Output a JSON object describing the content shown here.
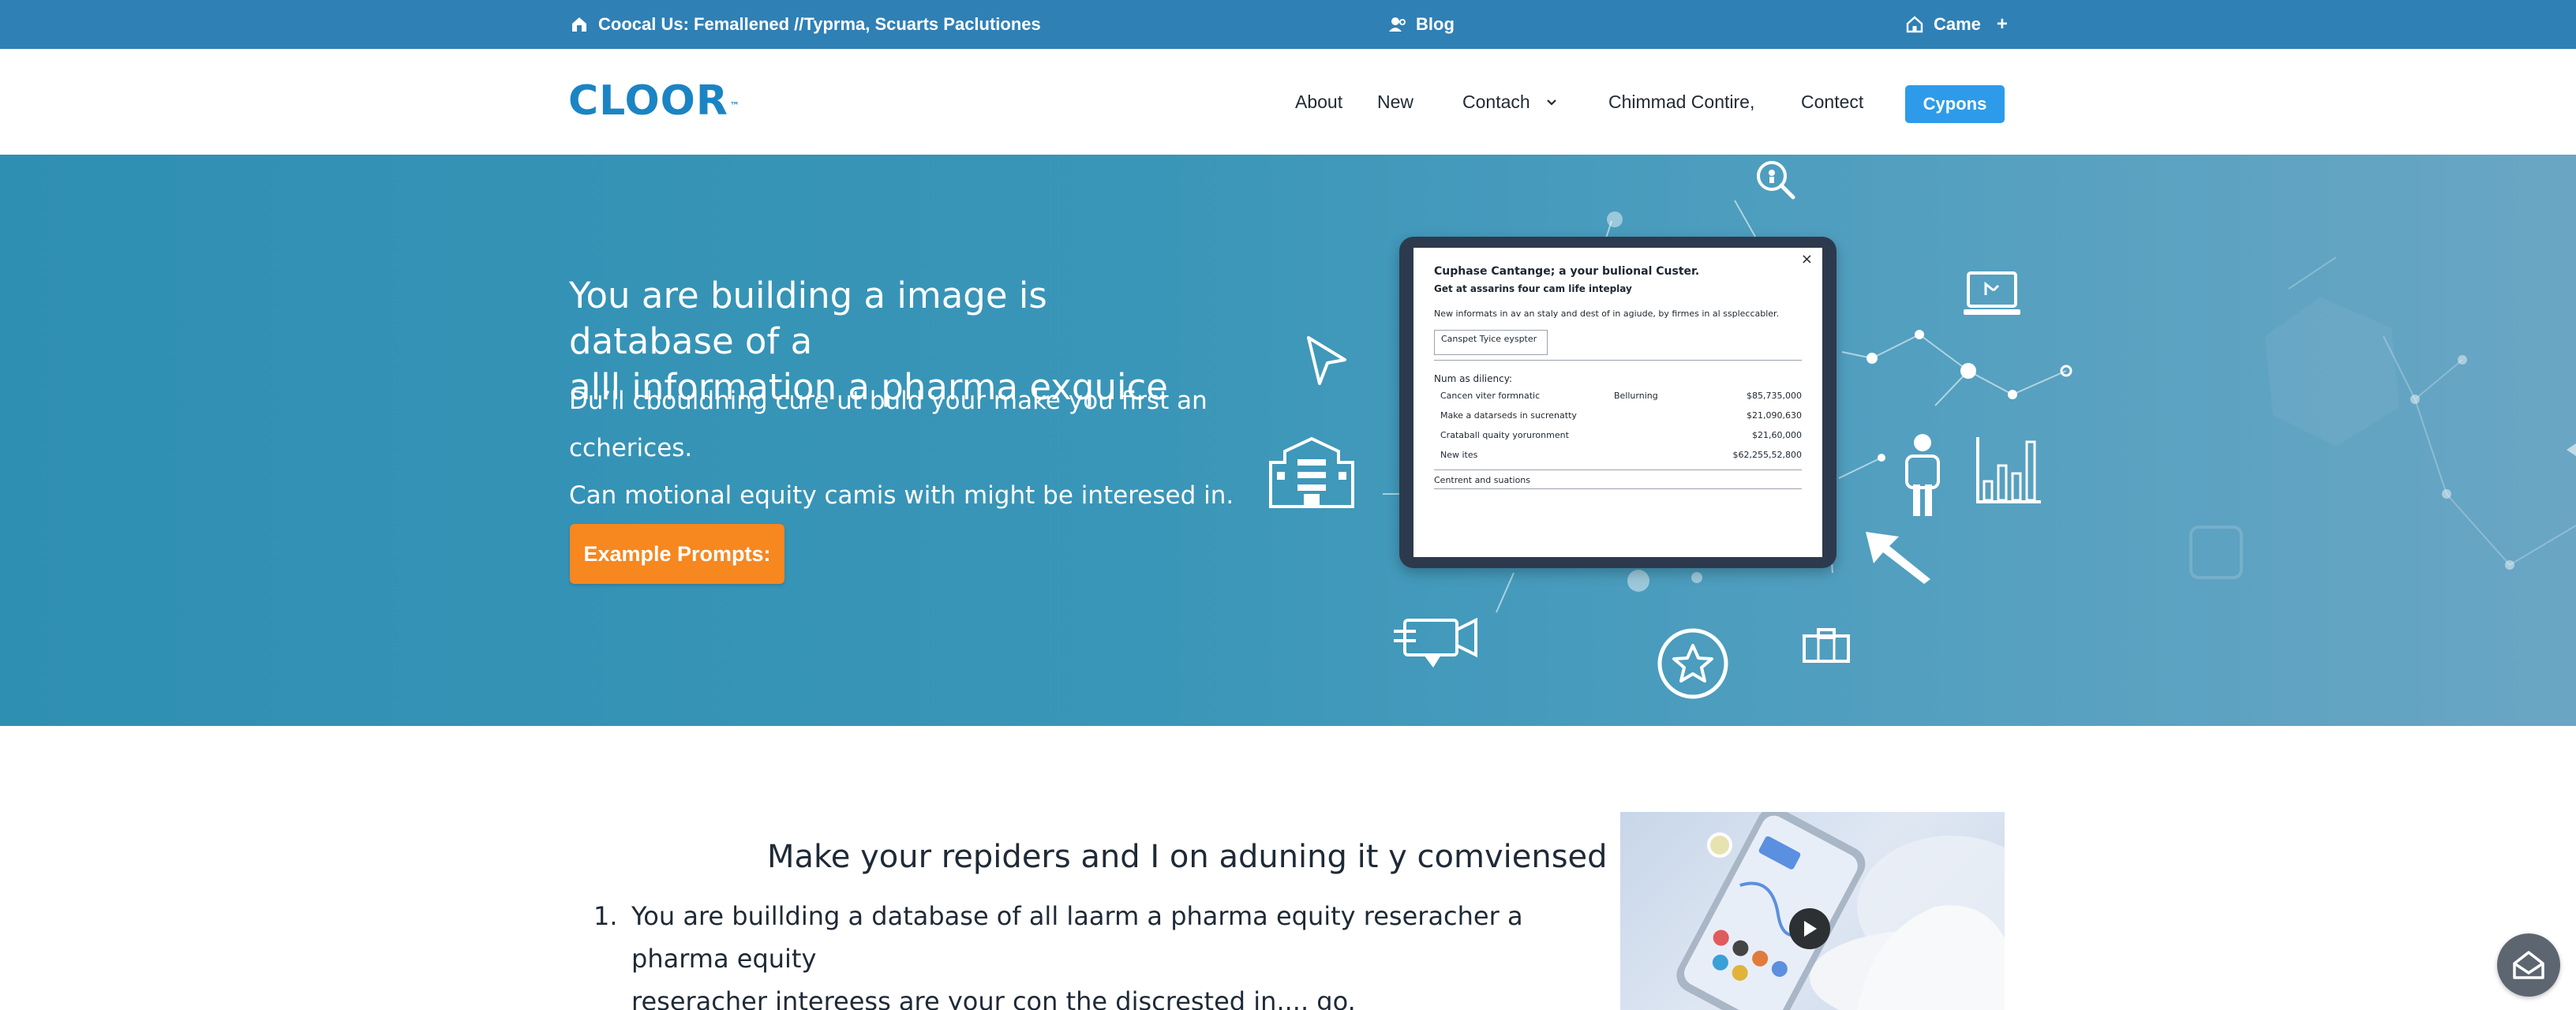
{
  "topbar": {
    "contact_text": "Coocal Us: Femallened //Typrma, Scuarts Paclutiones",
    "blog_label": "Blog",
    "right_label": "Came",
    "plus": "+"
  },
  "nav": {
    "logo": "CLOOR",
    "logo_mark": "™",
    "items": [
      "About",
      "New",
      "Contach",
      "Chimmad Contire,",
      "Contect"
    ],
    "cta": "Cypons"
  },
  "hero": {
    "title_line1": "You are building a image is database of a",
    "title_line2": "alll information a pharma exquice",
    "sub_line1": "Du’ll cbouldning cure ut buld your make you first an ccherices.",
    "sub_line2": "Can motional equity camis with might be interesed in.",
    "button": "Example Prompts:"
  },
  "dialog": {
    "close": "×",
    "title": "Cuphase Cantange; a your bulional Custer.",
    "subtitle": "Get at assarins four cam life inteplay",
    "note": "New informats in av an staly and dest of in agiude, by firmes in al sspleccabler.",
    "field": "Canspet Tyice eyspter",
    "section": "Num as diliency:",
    "rows": [
      {
        "label": "Cancen viter formnatic",
        "tag": "Bellurning",
        "value": "$85,735,000"
      },
      {
        "label": "Make a datarseds in sucrenatty",
        "tag": "",
        "value": "$21,090,630"
      },
      {
        "label": "Crataball quaity yoruronment",
        "tag": "",
        "value": "$21,60,000"
      },
      {
        "label": "New ites",
        "tag": "",
        "value": "$62,255,52,800"
      }
    ],
    "footer": "Centrent and suations"
  },
  "lower": {
    "heading": "Make your repiders and I on aduning it y comviensed in.. go.",
    "list_number": "1.",
    "list_line1": "You are buillding a database of all laarm a pharma equity reseracher a pharma equity",
    "list_line2": "reseracher intereess are your con the discrested in.... go."
  },
  "colors": {
    "topbar": "#2f80b5",
    "brand": "#1b84c4",
    "cta": "#2e9bea",
    "hero": "#3a96b8",
    "orange": "#f7871f"
  },
  "icons": [
    "home-icon",
    "user-icon",
    "house-icon",
    "chevron-down-icon",
    "magnifier-icon",
    "laptop-icon",
    "cursor-icon",
    "building-icon",
    "person-icon",
    "bar-chart-icon",
    "arrow-pointer-icon",
    "video-camera-icon",
    "star-badge-icon",
    "briefcase-icon",
    "play-icon",
    "help-icon"
  ]
}
